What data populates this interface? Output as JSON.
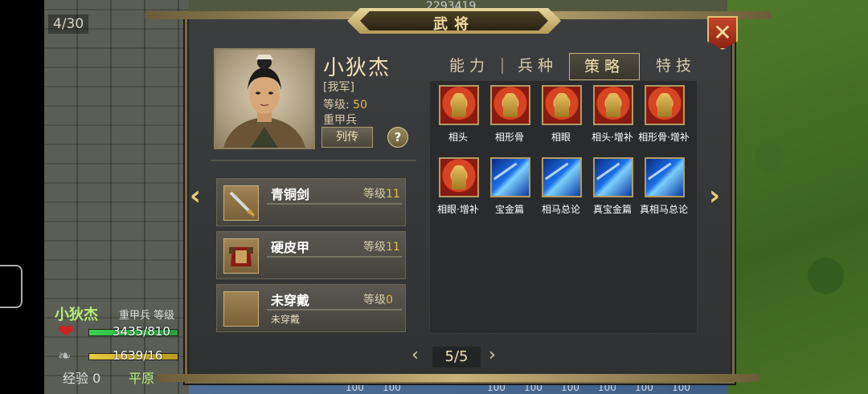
{
  "background": {
    "counter": "4/30",
    "top_number": "2293419",
    "unit_name": "小狄杰",
    "unit_type": "重甲兵 等级",
    "hp_text": "3435/810",
    "mp_text": "1639/16",
    "exp_label": "经验",
    "exp_value": "0",
    "terrain": "平原",
    "tile_numbers": [
      "100",
      "100",
      "100",
      "100",
      "100",
      "100",
      "100",
      "100"
    ]
  },
  "dialog": {
    "title": "武将",
    "close_icon": "close-icon"
  },
  "hero": {
    "name": "小狄杰",
    "faction": "[我军]",
    "level_label": "等级:",
    "level_value": "50",
    "class": "重甲兵",
    "bio_button": "列传",
    "help_button": "?"
  },
  "equipment": [
    {
      "name": "青铜剑",
      "level_label": "等级",
      "level": "11",
      "icon": "sword-icon",
      "sub": ""
    },
    {
      "name": "硬皮甲",
      "level_label": "等级",
      "level": "11",
      "icon": "armor-icon",
      "sub": ""
    },
    {
      "name": "未穿戴",
      "level_label": "等级",
      "level": "0",
      "icon": "empty-slot-icon",
      "sub": "未穿戴"
    }
  ],
  "tabs": [
    {
      "label": "能力",
      "active": false
    },
    {
      "label": "兵种",
      "active": false
    },
    {
      "label": "策略",
      "active": true
    },
    {
      "label": "特技",
      "active": false
    }
  ],
  "skills": [
    {
      "label": "相头",
      "icon": "red"
    },
    {
      "label": "相形骨",
      "icon": "red"
    },
    {
      "label": "相眼",
      "icon": "red"
    },
    {
      "label": "相头·增补",
      "icon": "red"
    },
    {
      "label": "相形骨·增补",
      "icon": "red"
    },
    {
      "label": "相眼·增补",
      "icon": "red"
    },
    {
      "label": "宝金篇",
      "icon": "blue"
    },
    {
      "label": "相马总论",
      "icon": "blue"
    },
    {
      "label": "真宝金篇",
      "icon": "blue"
    },
    {
      "label": "真相马总论",
      "icon": "blue"
    }
  ],
  "pager": {
    "text": "5/5",
    "prev": "‹",
    "next": "›"
  },
  "nav": {
    "left": "‹",
    "right": "›"
  },
  "colors": {
    "accent_gold": "#c8b27a",
    "level_orange": "#e8b848",
    "hp_green": "#3cd050"
  }
}
